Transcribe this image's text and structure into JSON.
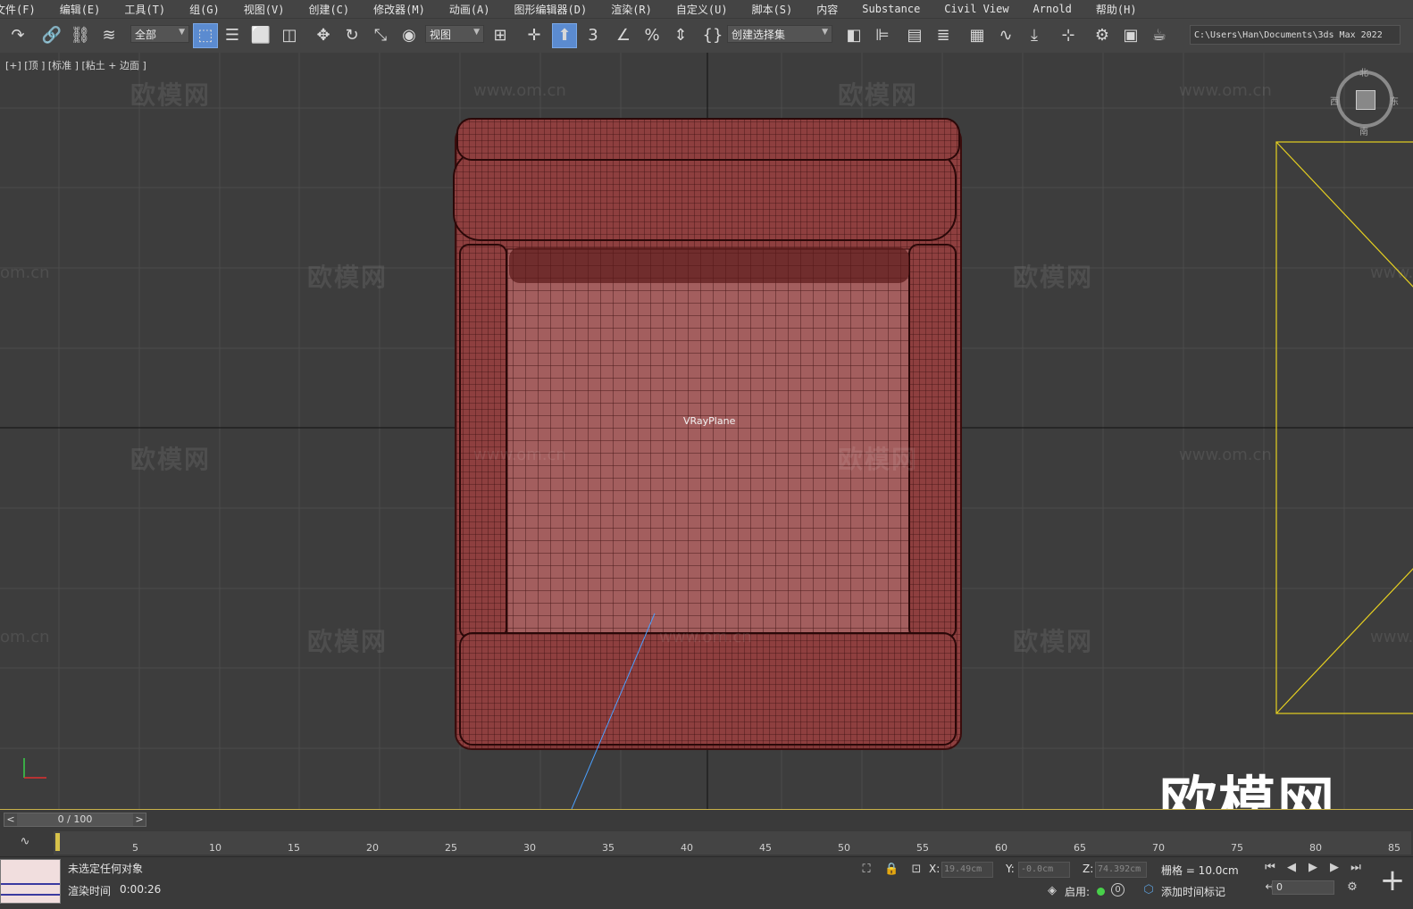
{
  "menubar": {
    "items": [
      "文件(F)",
      "编辑(E)",
      "工具(T)",
      "组(G)",
      "视图(V)",
      "创建(C)",
      "修改器(M)",
      "动画(A)",
      "图形编辑器(D)",
      "渲染(R)",
      "自定义(U)",
      "脚本(S)",
      "内容",
      "Substance",
      "Civil View",
      "Arnold",
      "帮助(H)"
    ]
  },
  "toolbar": {
    "filter_select": "全部",
    "refcoord_select": "视图",
    "selection_set": "创建选择集",
    "project_path": "C:\\Users\\Han\\Documents\\3ds Max 2022"
  },
  "viewport": {
    "label": "[+] [顶 ] [标准 ] [粘土 + 边面 ]",
    "object_label": "VRayPlane",
    "watermark_text": "欧模网",
    "watermark_url": "www.om.cn",
    "watermark_url_partial": "om.cn",
    "watermark_url_partial_right": "www.",
    "big_watermark": "欧模网",
    "viewcube": {
      "north": "北",
      "south": "南",
      "east": "东",
      "west": "西"
    }
  },
  "timeline": {
    "frame_display": "0 / 100",
    "prev_label": "<",
    "next_label": ">",
    "ticks": [
      "5",
      "10",
      "15",
      "20",
      "25",
      "30",
      "35",
      "40",
      "45",
      "50",
      "55",
      "60",
      "65",
      "70",
      "75",
      "80",
      "85"
    ]
  },
  "status": {
    "selection_msg": "未选定任何对象",
    "render_time_label": "渲染时间",
    "render_time": "0:00:26",
    "x_label": "X:",
    "x_value": "19.49cm",
    "y_label": "Y:",
    "y_value": "-0.0cm",
    "z_label": "Z:",
    "z_value": "74.392cm",
    "grid": "栅格 = 10.0cm",
    "enable_label": "启用:",
    "add_time_tag": "添加时间标记",
    "frame_value": "0"
  }
}
